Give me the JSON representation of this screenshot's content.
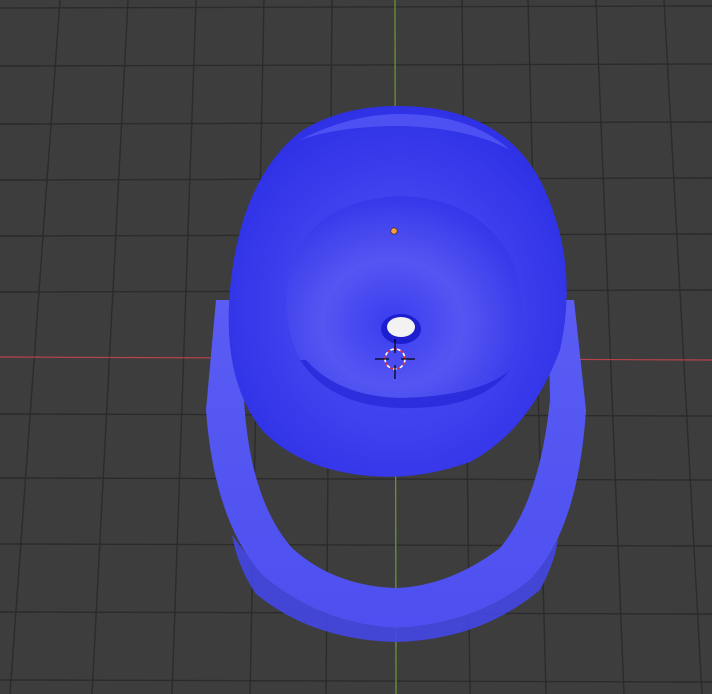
{
  "viewport": {
    "background": "#3d3d3d",
    "grid_color": "#2a2a2a",
    "x_axis_color": "#c0474f",
    "y_axis_color": "#6a9a2a"
  },
  "object": {
    "kind": "mesh",
    "color": "#4a4af0"
  },
  "scene_markers": {
    "origin_icon": "origin-dot-icon",
    "cursor_icon": "3d-cursor-icon"
  }
}
